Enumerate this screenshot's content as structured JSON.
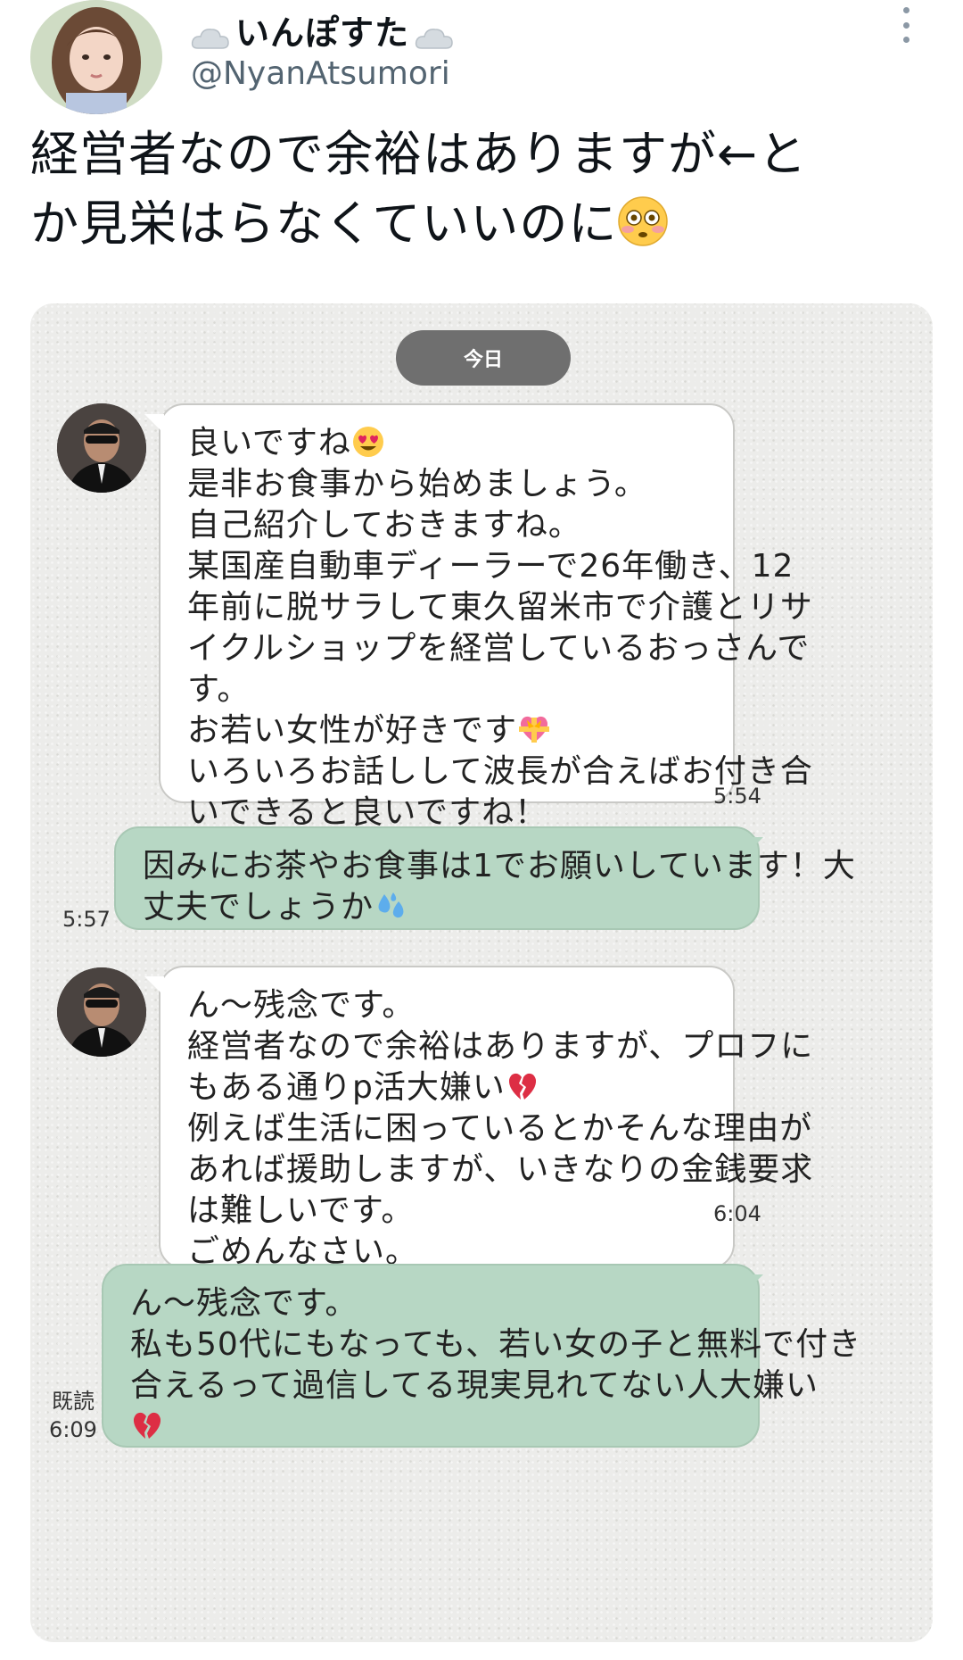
{
  "profile": {
    "name": "いんぽすた",
    "handle": "@NyanAtsumori"
  },
  "tweet": {
    "lines": [
      "経営者なので余裕はありますが←と",
      "か見栄はらなくていいのに"
    ],
    "emoji": "flushed-face"
  },
  "chat": {
    "date_chip": "今日",
    "messages": [
      {
        "side": "in",
        "lines": [
          "良いですね",
          "是非お食事から始めましょう。",
          "自己紹介しておきますね。",
          "某国産自動車ディーラーで26年働き、12",
          "年前に脱サラして東久留米市で介護とリサ",
          "イクルショップを経営しているおっさんで",
          "す。",
          "お若い女性が好きです",
          "いろいろお話しして波長が合えばお付き合",
          "いできると良いですね！"
        ],
        "time": "5:54"
      },
      {
        "side": "out",
        "lines": [
          "因みにお茶やお食事は1でお願いしています！大",
          "丈夫でしょうか"
        ],
        "time": "5:57"
      },
      {
        "side": "in",
        "lines": [
          "ん〜残念です。",
          "経営者なので余裕はありますが、プロフに",
          "もある通りp活大嫌い",
          "例えば生活に困っているとかそんな理由が",
          "あれば援助しますが、いきなりの金銭要求",
          "は難しいです。",
          "ごめんなさい。"
        ],
        "time": "6:04"
      },
      {
        "side": "out",
        "lines": [
          "ん〜残念です。",
          "私も50代にもなっても、若い女の子と無料で付き",
          "合えるって過信してる現実見れてない人大嫌い"
        ],
        "read": "既読",
        "time": "6:09"
      }
    ]
  }
}
